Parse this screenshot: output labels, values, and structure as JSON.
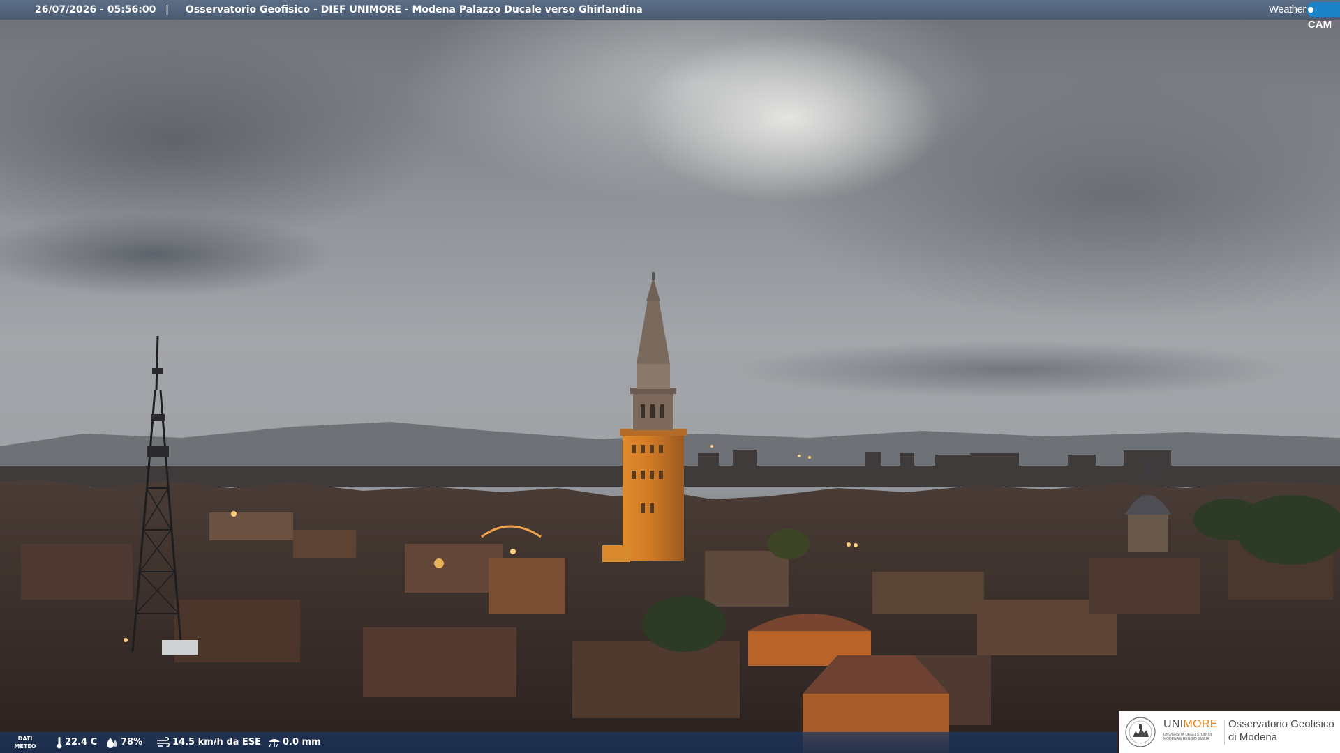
{
  "overlay": {
    "datetime": "26/07/2026 - 05:56:00",
    "separator": "|",
    "camera_title": "Osservatorio Geofisico - DIEF UNIMORE - Modena Palazzo Ducale verso Ghirlandina"
  },
  "brand": {
    "weather_text": "Weather",
    "cam_text": "CAM"
  },
  "weather": {
    "label_line1": "DATI",
    "label_line2": "METEO",
    "temperature": "22.4 C",
    "humidity": "78%",
    "wind": "14.5 km/h da ESE",
    "rain": "0.0 mm"
  },
  "logo": {
    "unimore_part1": "UNI",
    "unimore_part2": "MORE",
    "university_line1": "UNIVERSITÀ DEGLI STUDI DI",
    "university_line2": "MODENA E REGGIO EMILIA",
    "observatory_line1": "Osservatorio Geofisico",
    "observatory_line2": "di Modena"
  },
  "colors": {
    "topbar": "#546680",
    "bottombar": "#1e375f",
    "brand_blue": "#1b83c7",
    "unimore_orange": "#e8831e",
    "tower_lit": "#c8701e"
  },
  "icons": {
    "temperature": "thermometer-icon",
    "humidity": "water-drop-icon",
    "wind": "wind-icon",
    "rain": "rain-gauge-icon"
  }
}
